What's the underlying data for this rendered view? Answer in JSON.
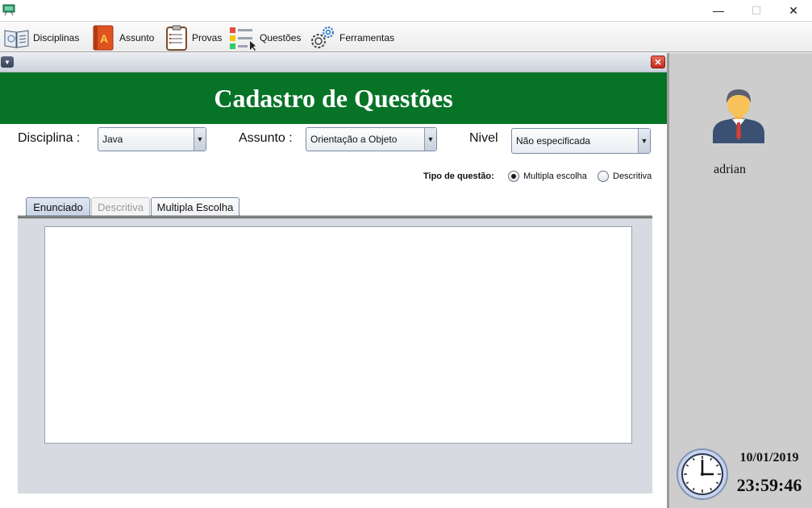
{
  "window": {
    "minimize_glyph": "—",
    "maximize_glyph": "☐",
    "close_glyph": "✕"
  },
  "menu": [
    {
      "label": "Disciplinas",
      "icon": "book-icon"
    },
    {
      "label": "Assunto",
      "icon": "notebook-icon"
    },
    {
      "label": "Provas",
      "icon": "clipboard-icon"
    },
    {
      "label": "Questões",
      "icon": "checklist-icon"
    },
    {
      "label": "Ferramentas",
      "icon": "gear-icon"
    }
  ],
  "frame": {
    "title": "Cadastro de Questões",
    "close_glyph": "✕",
    "menu_glyph": "▼"
  },
  "form": {
    "disciplina_label": "Disciplina :",
    "disciplina_value": "Java",
    "assunto_label": "Assunto :",
    "assunto_value": "Orientação a Objeto",
    "nivel_label": "Nivel",
    "nivel_value": "Não especificada",
    "dropdown_glyph": "▼",
    "tipo_label": "Tipo de questão:",
    "radio_multipla": "Multipla escolha",
    "radio_descritiva": "Descritiva",
    "selected_tipo": "Multipla escolha"
  },
  "tabs": [
    {
      "label": "Enunciado",
      "state": "active"
    },
    {
      "label": "Descritiva",
      "state": "disabled"
    },
    {
      "label": "Multipla Escolha",
      "state": "normal"
    }
  ],
  "enunciado_text": "",
  "side": {
    "username": "adrian",
    "date": "10/01/2019",
    "time": "23:59:46"
  },
  "colors": {
    "header_green": "#067327",
    "side_gray": "#cdcdcd",
    "panel_gray": "#d7dae0"
  }
}
